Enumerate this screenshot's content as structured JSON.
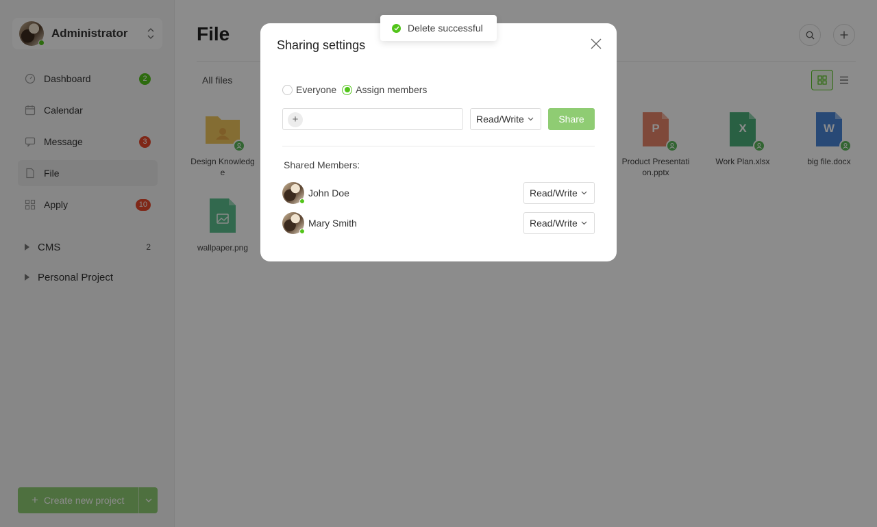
{
  "sidebar": {
    "user": {
      "name": "Administrator",
      "avatar_icon": "user-avatar-icon",
      "status_color": "#52c41a"
    },
    "nav": [
      {
        "label": "Dashboard",
        "icon": "dashboard-icon",
        "badge": "2",
        "badge_color": "#52c41a"
      },
      {
        "label": "Calendar",
        "icon": "calendar-icon"
      },
      {
        "label": "Message",
        "icon": "message-icon",
        "badge": "3",
        "badge_color": "#e8472b"
      },
      {
        "label": "File",
        "icon": "file-icon",
        "active": true
      },
      {
        "label": "Apply",
        "icon": "apps-grid-icon",
        "badge": "10",
        "badge_color": "#e8472b"
      }
    ],
    "groups": [
      {
        "label": "CMS",
        "count": "2"
      },
      {
        "label": "Personal Project",
        "count": ""
      }
    ],
    "create_button": "Create new project"
  },
  "main": {
    "title": "File",
    "breadcrumb": "All files",
    "files": [
      {
        "name": "Design Knowledge",
        "type": "shared-folder",
        "color": "#f0c75e"
      },
      {
        "name": "Product Presentation.pptx",
        "type": "pptx",
        "letter": "P",
        "color": "#e8866a"
      },
      {
        "name": "Work Plan.xlsx",
        "type": "xlsx",
        "letter": "X",
        "color": "#4caf7a"
      },
      {
        "name": "big file.docx",
        "type": "docx",
        "letter": "W",
        "color": "#4a86d8"
      },
      {
        "name": "wallpaper.png",
        "type": "image",
        "color": "#5bbf8e"
      }
    ]
  },
  "modal": {
    "title": "Sharing settings",
    "radios": [
      {
        "label": "Everyone",
        "checked": false
      },
      {
        "label": "Assign members",
        "checked": true
      }
    ],
    "input": {
      "value": "",
      "placeholder": ""
    },
    "permission": "Read/Write",
    "share_button": "Share",
    "shared_label": "Shared Members:",
    "members": [
      {
        "name": "John Doe",
        "permission": "Read/Write"
      },
      {
        "name": "Mary Smith",
        "permission": "Read/Write"
      }
    ]
  },
  "toast": {
    "message": "Delete successful",
    "icon": "check-circle-icon"
  },
  "colors": {
    "accent": "#52c41a",
    "accent_light": "#8fcc73",
    "danger": "#e8472b"
  }
}
